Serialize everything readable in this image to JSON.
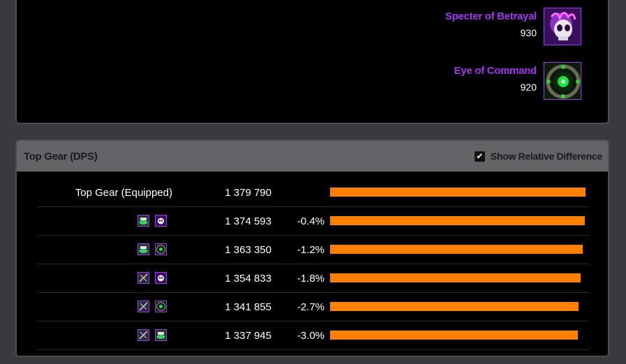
{
  "items": [
    {
      "name": "Specter of Betrayal",
      "ilvl": "930",
      "icon": "skull-trinket-icon"
    },
    {
      "name": "Eye of Command",
      "ilvl": "920",
      "icon": "eye-trinket-icon"
    }
  ],
  "top_gear": {
    "title": "Top Gear (DPS)",
    "toggle_label": "Show Relative Difference",
    "toggle_checked": true,
    "rows": [
      {
        "label": "Top Gear (Equipped)",
        "dps": "1 379 790",
        "diff": "",
        "fraction": 1.0,
        "icons": []
      },
      {
        "label": "",
        "dps": "1 374 593",
        "diff": "-0.4%",
        "fraction": 0.9962,
        "icons": [
          "ring-green-icon",
          "skull-trinket-icon"
        ]
      },
      {
        "label": "",
        "dps": "1 363 350",
        "diff": "-1.2%",
        "fraction": 0.9881,
        "icons": [
          "ring-green-icon",
          "eye-trinket-icon"
        ]
      },
      {
        "label": "",
        "dps": "1 354 833",
        "diff": "-1.8%",
        "fraction": 0.9819,
        "icons": [
          "sword-ring-icon",
          "skull-trinket-icon"
        ]
      },
      {
        "label": "",
        "dps": "1 341 855",
        "diff": "-2.7%",
        "fraction": 0.9725,
        "icons": [
          "sword-ring-icon",
          "eye-trinket-icon"
        ]
      },
      {
        "label": "",
        "dps": "1 337 945",
        "diff": "-3.0%",
        "fraction": 0.9697,
        "icons": [
          "sword-ring-icon",
          "ring-green-icon"
        ]
      }
    ]
  },
  "colors": {
    "epic": "#a335ee",
    "bar": "#ff8000"
  }
}
